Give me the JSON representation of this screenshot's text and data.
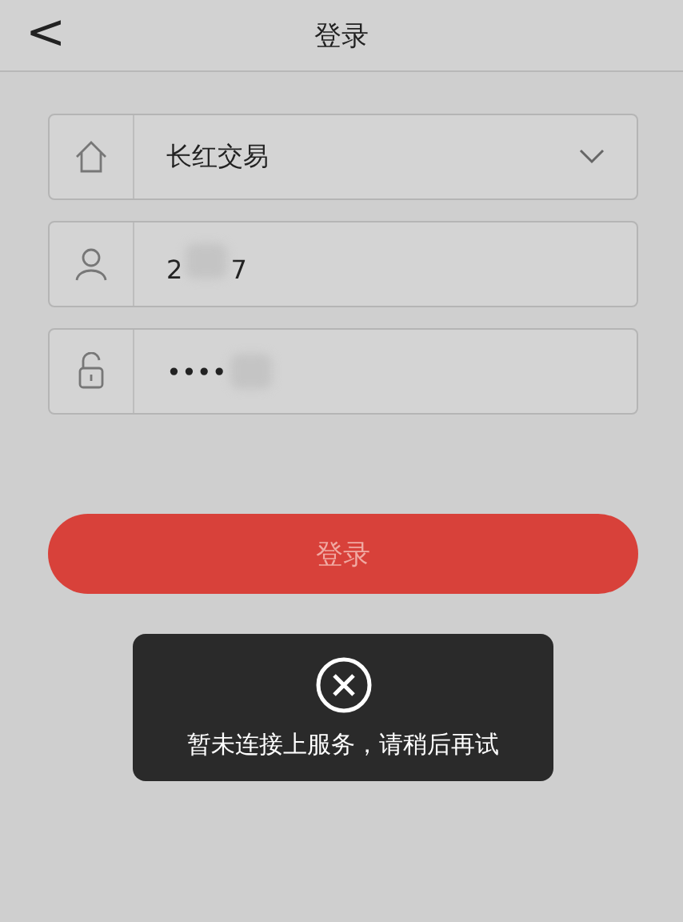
{
  "header": {
    "back": "<",
    "title": "登录"
  },
  "fields": [
    {
      "kind": "select",
      "value": "长红交易"
    },
    {
      "kind": "user",
      "value_start": "2",
      "value_end": "7"
    },
    {
      "kind": "password",
      "value": "••••"
    }
  ],
  "login_button": {
    "label": "登录",
    "disabled": true
  },
  "toast": {
    "message": "暂未连接上服务，请稍后再试"
  }
}
